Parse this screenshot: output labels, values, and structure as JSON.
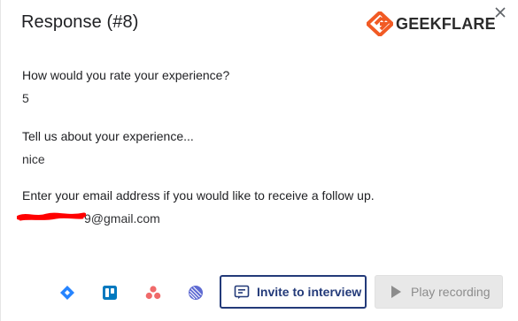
{
  "dialog": {
    "title": "Response (#8)",
    "brand": "GEEKFLARE",
    "close_icon": "close-icon"
  },
  "responses": [
    {
      "question": "How would you rate your experience?",
      "answer": "5"
    },
    {
      "question": "Tell us about your experience...",
      "answer": "nice"
    },
    {
      "question": "Enter your email address if you would like to receive a follow up.",
      "answer_visible": "9@gmail.com",
      "answer_redacted": true
    }
  ],
  "integrations": [
    {
      "name": "jira-icon"
    },
    {
      "name": "trello-icon"
    },
    {
      "name": "asana-icon"
    },
    {
      "name": "linear-icon"
    }
  ],
  "actions": {
    "invite_label": "Invite to interview",
    "play_label": "Play recording"
  },
  "colors": {
    "brand_orange": "#f15a24",
    "primary": "#233a79",
    "jira": "#2684ff",
    "trello": "#0079bf",
    "asana": "#f06a6a",
    "linear": "#5e6ad2",
    "redaction": "#ff0000"
  }
}
